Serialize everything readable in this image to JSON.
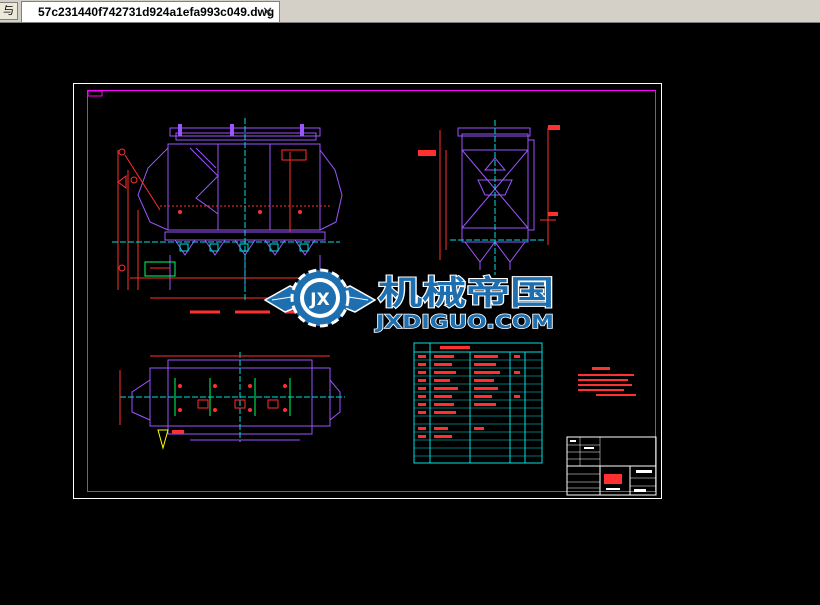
{
  "tabs": {
    "stub_label": "与",
    "active": {
      "title": "57c231440f742731d924a1efa993c049.dwg",
      "close_glyph": "✕"
    }
  },
  "watermark": {
    "logo_letters": "JX",
    "brand_cn": "机械帝国",
    "brand_en": "JXDIGUO.COM"
  },
  "colors": {
    "background": "#000000",
    "sheet_border": "#ffffff",
    "frame": "#ff00ff",
    "drawing_primary": "#9a55ff",
    "drawing_detail": "#ff3030",
    "centerline": "#00e0e0",
    "dimension": "#00ff66",
    "watermark_fill": "#1e6fb0",
    "watermark_accent": "#ffffff"
  }
}
